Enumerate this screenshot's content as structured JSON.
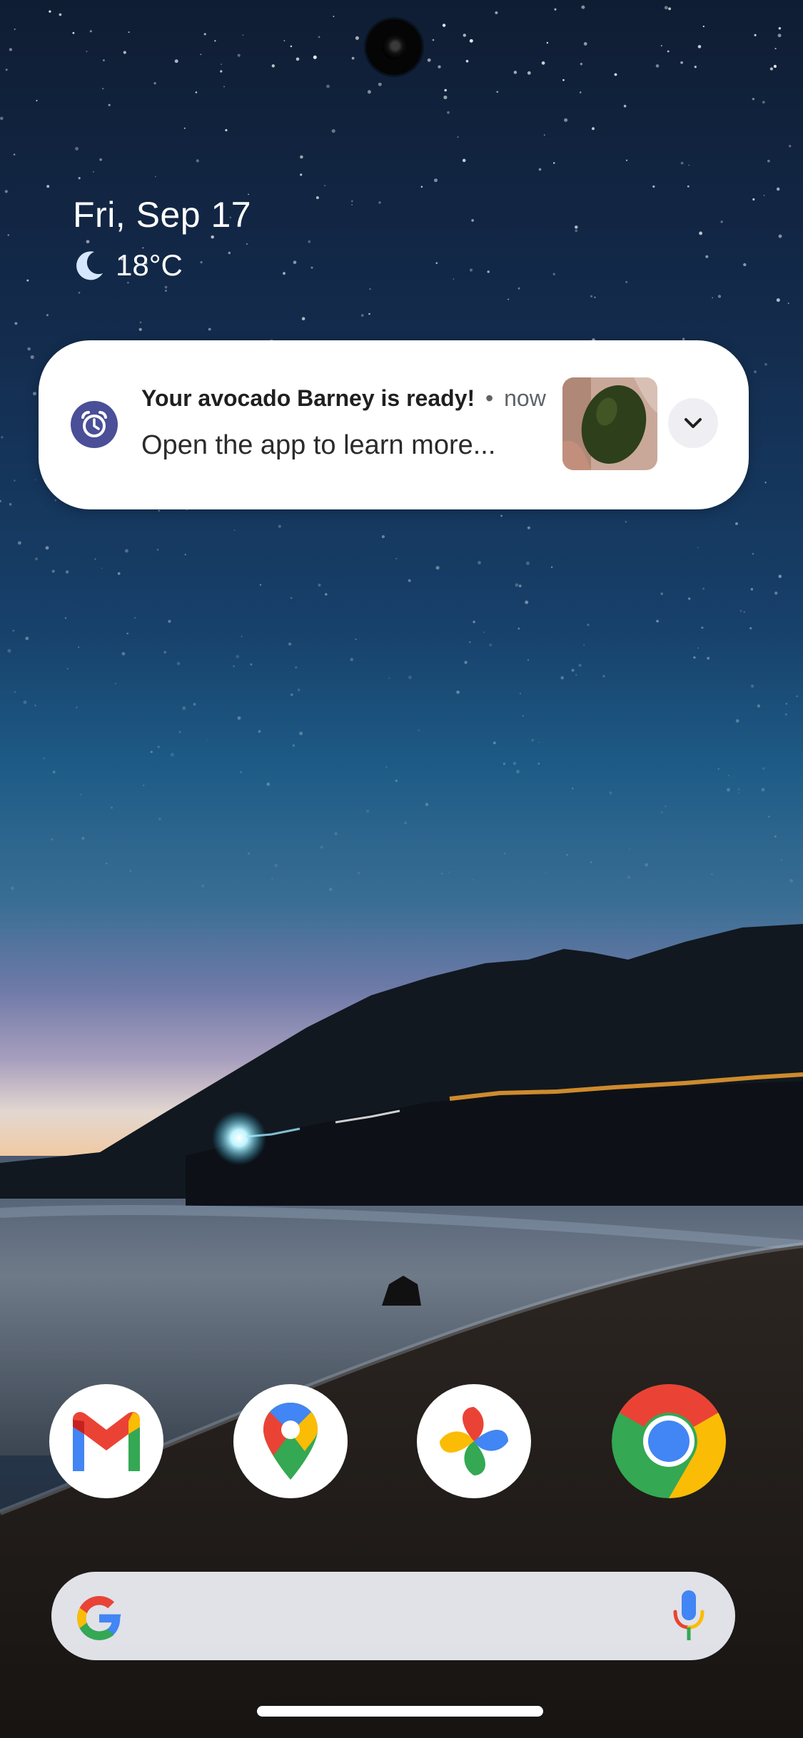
{
  "at_a_glance": {
    "date": "Fri, Sep 17",
    "weather_icon": "moon-icon",
    "temperature": "18°C"
  },
  "notification": {
    "app_icon": "alarm-clock-icon",
    "title": "Your avocado Barney is ready!",
    "separator": "•",
    "time": "now",
    "body": "Open the app to learn more...",
    "thumbnail": "avocado-photo",
    "expand_icon": "chevron-down-icon"
  },
  "dock": {
    "apps": [
      {
        "name": "Gmail",
        "icon": "gmail-icon"
      },
      {
        "name": "Maps",
        "icon": "maps-pin-icon"
      },
      {
        "name": "Photos",
        "icon": "photos-pinwheel-icon"
      },
      {
        "name": "Chrome",
        "icon": "chrome-icon"
      }
    ]
  },
  "search_bar": {
    "logo": "google-g-icon",
    "mic": "microphone-icon"
  },
  "colors": {
    "notification_bg": "#ffffff",
    "app_icon_bg": "#4a4f97",
    "google_blue": "#4285F4",
    "google_red": "#EA4335",
    "google_yellow": "#FBBC05",
    "google_green": "#34A853"
  }
}
